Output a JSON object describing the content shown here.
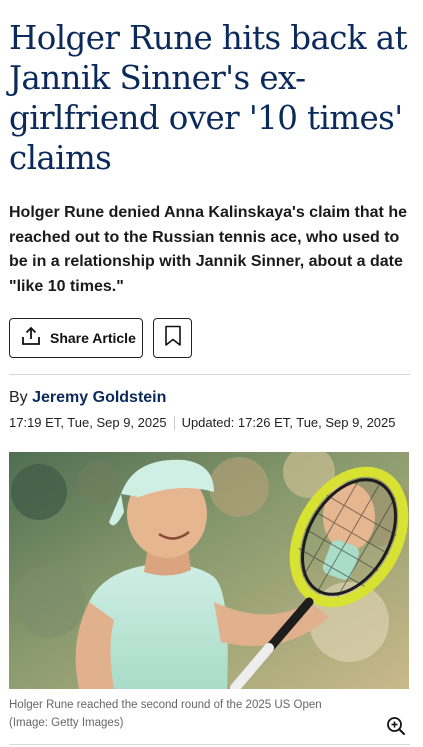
{
  "article": {
    "headline": "Holger Rune hits back at Jannik Sinner's ex-girlfriend over '10 times' claims",
    "standfirst": "Holger Rune denied Anna Kalinskaya's claim that he reached out to the Russian tennis ace, who used to be in a relationship with Jannik Sinner, about a date \"like 10 times.\"",
    "byline_prefix": "By",
    "author": "Jeremy Goldstein",
    "published": "17:19 ET, Tue, Sep 9, 2025",
    "updated": "Updated: 17:26 ET, Tue, Sep 9, 2025"
  },
  "actions": {
    "share_label": "Share Article",
    "share_icon": "share-upload-icon",
    "bookmark_icon": "bookmark-icon"
  },
  "image": {
    "caption": "Holger Rune reached the second round of the 2025 US Open",
    "credit": "(Image: Getty Images)",
    "zoom_icon": "zoom-in-icon"
  }
}
